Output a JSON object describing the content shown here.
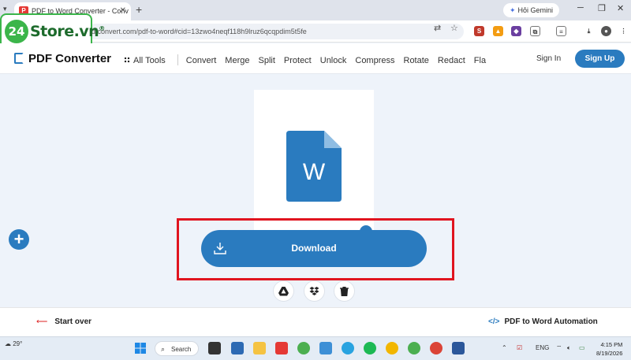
{
  "browser": {
    "tab_title": "PDF to Word Converter - Conv",
    "url": "dfconvert.com/pdf-to-word#cid=13zwo4neqf118h9lruz6qcqpdim5t5fe",
    "gemini_label": "Hỏi Gemini"
  },
  "watermark": {
    "badge": "24",
    "text": "Store.vn",
    "reg": "®"
  },
  "header": {
    "brand": "PDF Converter",
    "all_tools": "All Tools",
    "nav": [
      "Convert",
      "Merge",
      "Split",
      "Protect",
      "Unlock",
      "Compress",
      "Rotate",
      "Redact",
      "Fla"
    ],
    "sign_in": "Sign In",
    "sign_up": "Sign Up"
  },
  "main": {
    "doc_letter": "W",
    "download_label": "Download"
  },
  "footer": {
    "start_over": "Start over",
    "automation": "PDF to Word Automation"
  },
  "taskbar": {
    "weather_temp": "29°",
    "search_label": "Search",
    "language": "ENG",
    "time": "4:15 PM",
    "date": "8/19/2026"
  },
  "colors": {
    "accent": "#2a7bbf",
    "highlight": "#e0141f",
    "watermark": "#3bb54a"
  }
}
